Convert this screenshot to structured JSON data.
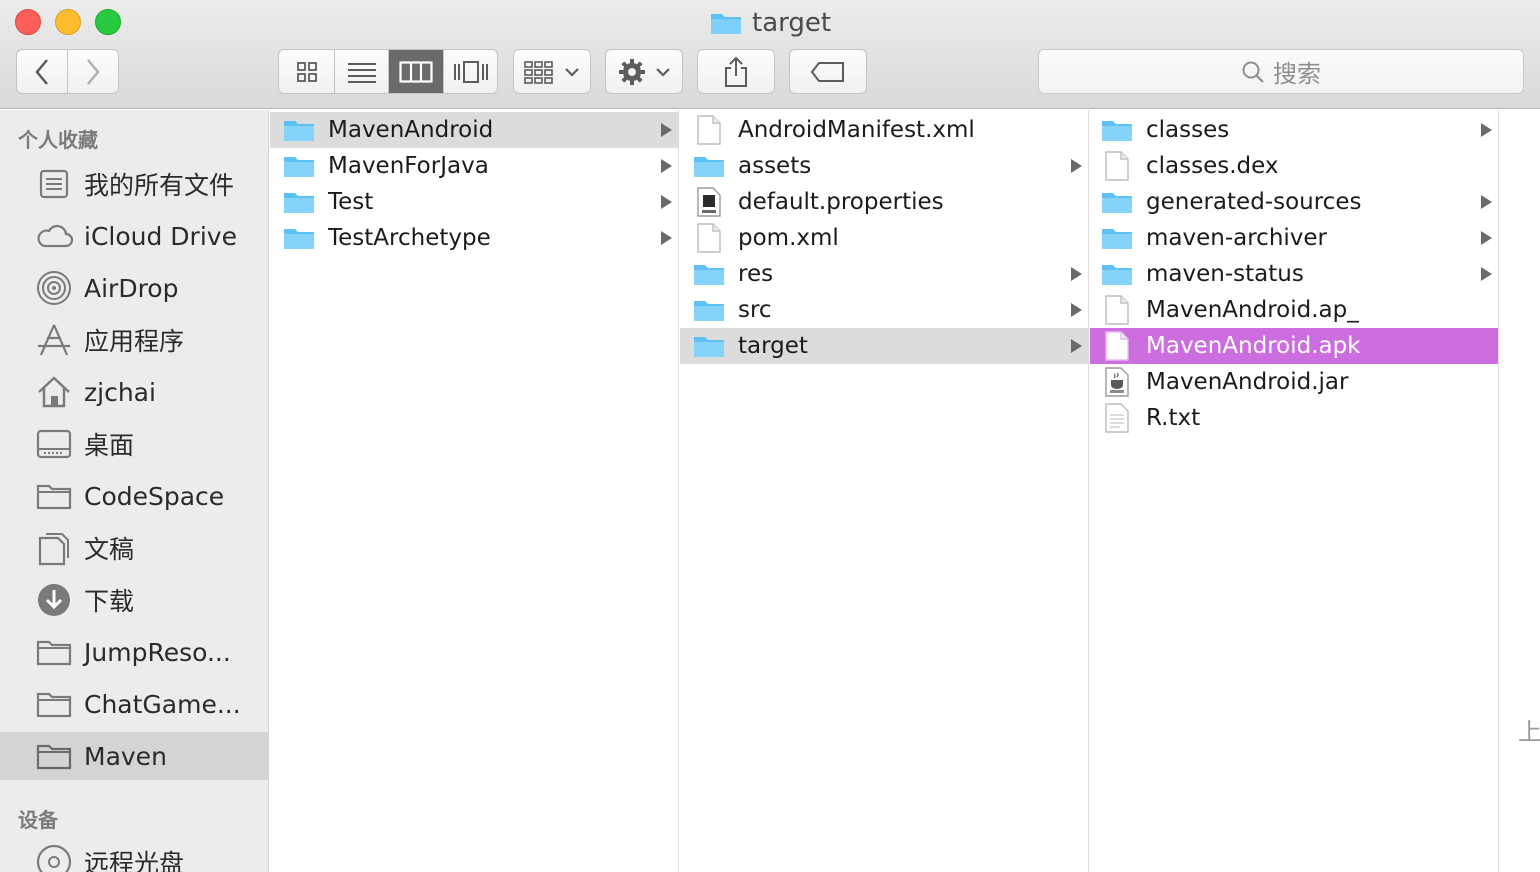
{
  "window": {
    "title": "target"
  },
  "toolbar": {
    "search_placeholder": "搜索",
    "back_icon": "chevron-left-icon",
    "forward_icon": "chevron-right-icon"
  },
  "sidebar": {
    "favorites_header": "个人收藏",
    "devices_header": "设备",
    "items": [
      {
        "label": "我的所有文件",
        "icon": "all-files-icon"
      },
      {
        "label": "iCloud Drive",
        "icon": "cloud-icon"
      },
      {
        "label": "AirDrop",
        "icon": "airdrop-icon"
      },
      {
        "label": "应用程序",
        "icon": "applications-icon"
      },
      {
        "label": "zjchai",
        "icon": "home-icon"
      },
      {
        "label": "桌面",
        "icon": "desktop-icon"
      },
      {
        "label": "CodeSpace",
        "icon": "folder-icon"
      },
      {
        "label": "文稿",
        "icon": "documents-icon"
      },
      {
        "label": "下载",
        "icon": "download-icon"
      },
      {
        "label": "JumpReso...",
        "icon": "folder-icon"
      },
      {
        "label": "ChatGame...",
        "icon": "folder-icon"
      },
      {
        "label": "Maven",
        "icon": "folder-icon"
      }
    ],
    "devices": [
      {
        "label": "远程光盘",
        "icon": "disc-icon"
      }
    ]
  },
  "columns": [
    {
      "items": [
        {
          "name": "MavenAndroid",
          "type": "folder",
          "arrow": true
        },
        {
          "name": "MavenForJava",
          "type": "folder",
          "arrow": true
        },
        {
          "name": "Test",
          "type": "folder",
          "arrow": true
        },
        {
          "name": "TestArchetype",
          "type": "folder",
          "arrow": true
        }
      ]
    },
    {
      "items": [
        {
          "name": "AndroidManifest.xml",
          "type": "file",
          "arrow": false
        },
        {
          "name": "assets",
          "type": "folder",
          "arrow": true
        },
        {
          "name": "default.properties",
          "type": "java-file",
          "arrow": false
        },
        {
          "name": "pom.xml",
          "type": "file",
          "arrow": false
        },
        {
          "name": "res",
          "type": "folder",
          "arrow": true
        },
        {
          "name": "src",
          "type": "folder",
          "arrow": true
        },
        {
          "name": "target",
          "type": "folder",
          "arrow": true
        }
      ]
    },
    {
      "items": [
        {
          "name": "classes",
          "type": "folder",
          "arrow": true
        },
        {
          "name": "classes.dex",
          "type": "file",
          "arrow": false
        },
        {
          "name": "generated-sources",
          "type": "folder",
          "arrow": true
        },
        {
          "name": "maven-archiver",
          "type": "folder",
          "arrow": true
        },
        {
          "name": "maven-status",
          "type": "folder",
          "arrow": true
        },
        {
          "name": "MavenAndroid.ap_",
          "type": "file",
          "arrow": false
        },
        {
          "name": "MavenAndroid.apk",
          "type": "file",
          "arrow": false
        },
        {
          "name": "MavenAndroid.jar",
          "type": "jar-file",
          "arrow": false
        },
        {
          "name": "R.txt",
          "type": "text-file",
          "arrow": false
        }
      ]
    }
  ],
  "edge_text": "上",
  "colors": {
    "selection_active": "#cd6ee0",
    "selection_inactive": "#dcdcdc",
    "folder_blue": "#5ec1f5"
  }
}
